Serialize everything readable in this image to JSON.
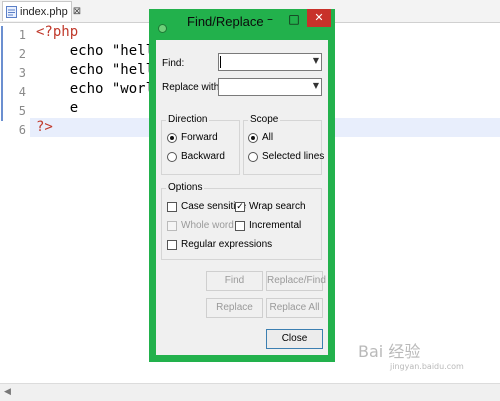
{
  "editor": {
    "tab_label": "index.php",
    "tab_close": "⊠",
    "line_numbers": [
      "1",
      "2",
      "3",
      "4",
      "5",
      "6"
    ],
    "lines": [
      "<?php",
      "    echo \"hello w",
      "    echo \"hello\"",
      "    echo \"world\"",
      "    e",
      "?>"
    ]
  },
  "dialog": {
    "title": "Find/Replace",
    "minimize": "–",
    "maximize": "□",
    "close_icon": "✕",
    "find_label": "Find:",
    "find_value": "",
    "replace_label": "Replace with:",
    "replace_value": "",
    "direction": {
      "title": "Direction",
      "forward": "Forward",
      "backward": "Backward",
      "selected": "Forward"
    },
    "scope": {
      "title": "Scope",
      "all": "All",
      "selected_lines": "Selected lines",
      "selected": "All"
    },
    "options": {
      "title": "Options",
      "case_sensitive": "Case sensitive",
      "wrap_search": "Wrap search",
      "whole_word": "Whole word",
      "incremental": "Incremental",
      "regular_expressions": "Regular expressions",
      "case_sensitive_checked": false,
      "wrap_search_checked": true,
      "whole_word_checked": false,
      "incremental_checked": false,
      "regular_expressions_checked": false
    },
    "buttons": {
      "find": "Find",
      "replace_find": "Replace/Find",
      "replace": "Replace",
      "replace_all": "Replace All",
      "close": "Close"
    }
  },
  "watermark": {
    "text": "Bai 经验",
    "url": "jingyan.baidu.com"
  },
  "colors": {
    "dialog_frame": "#22b14c",
    "close_red": "#c8312a",
    "php_tag": "#c0392b"
  }
}
